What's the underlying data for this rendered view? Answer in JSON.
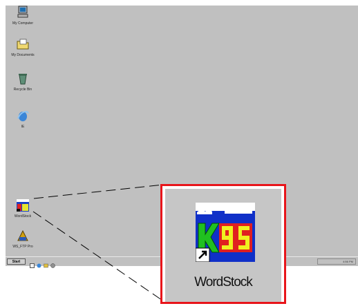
{
  "desktop_icons": [
    {
      "label": "My Computer",
      "icon": "my-computer-icon"
    },
    {
      "label": "My Documents",
      "icon": "my-documents-icon"
    },
    {
      "label": "Recycle Bin",
      "icon": "recycle-bin-icon"
    },
    {
      "label": "IE",
      "icon": "internet-explorer-icon"
    },
    {
      "label": "WordStock",
      "icon": "wordstock-icon"
    },
    {
      "label": "WS_FTP Pro",
      "icon": "ws-ftp-icon"
    }
  ],
  "taskbar": {
    "start_label": "Start",
    "quick_launch": [
      "show-desktop-icon",
      "internet-explorer-icon",
      "outlook-icon",
      "media-icon"
    ],
    "clock": "4:56 PM"
  },
  "callout": {
    "label": "WordStock",
    "icon_text": "K95",
    "border_color": "#e8141a"
  }
}
